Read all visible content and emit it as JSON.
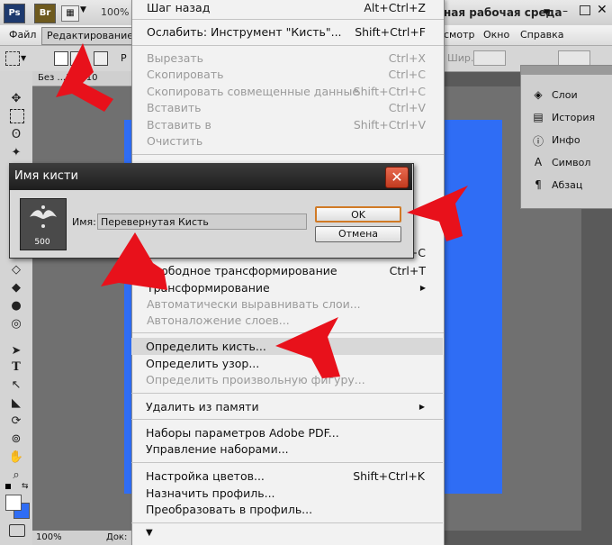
{
  "appbar": {
    "ps_label": "Ps",
    "br_label": "Br",
    "zoom": "100%",
    "workspace": "ная рабочая среда",
    "workspace_caret": "▼"
  },
  "menubar": {
    "file": "Файл",
    "edit": "Редактирование",
    "view": "смотр",
    "window": "Окно",
    "help": "Справка"
  },
  "optbar": {
    "tool_label": "Р",
    "width_label": "Шир.:"
  },
  "doc": {
    "tab": "Без ...1 @ 10",
    "status_zoom": "100%",
    "status_doc": "Док:"
  },
  "panel": {
    "items": [
      {
        "label": "Слои",
        "icon": "layers-icon"
      },
      {
        "label": "История",
        "icon": "history-icon"
      },
      {
        "label": "Инфо",
        "icon": "info-icon"
      },
      {
        "label": "Символ",
        "icon": "character-icon"
      },
      {
        "label": "Абзац",
        "icon": "paragraph-icon"
      }
    ]
  },
  "menu": {
    "undo": {
      "label": "Шаг назад",
      "shortcut": "Alt+Ctrl+Z"
    },
    "fade": {
      "label": "Ослабить: Инструмент \"Кисть\"...",
      "shortcut": "Shift+Ctrl+F"
    },
    "cut": {
      "label": "Вырезать",
      "shortcut": "Ctrl+X"
    },
    "copy": {
      "label": "Скопировать",
      "shortcut": "Ctrl+C"
    },
    "copy_merged": {
      "label": "Скопировать совмещенные данные",
      "shortcut": "Shift+Ctrl+C"
    },
    "paste": {
      "label": "Вставить",
      "shortcut": "Ctrl+V"
    },
    "paste_into": {
      "label": "Вставить в",
      "shortcut": "Shift+Ctrl+V"
    },
    "clear": {
      "label": "Очистить"
    },
    "hidden_shortcut": "Alt+Ctrl+C",
    "free_transform": {
      "label": "Свободное трансформирование",
      "shortcut": "Ctrl+T"
    },
    "transform": {
      "label": "Трансформирование"
    },
    "auto_align": {
      "label": "Автоматически выравнивать слои..."
    },
    "auto_blend": {
      "label": "Автоналожение слоев..."
    },
    "define_brush": {
      "label": "Определить кисть..."
    },
    "define_pattern": {
      "label": "Определить узор..."
    },
    "define_shape": {
      "label": "Определить произвольную фигуру..."
    },
    "purge": {
      "label": "Удалить из памяти"
    },
    "pdf_presets": {
      "label": "Наборы параметров Adobe PDF..."
    },
    "preset_manager": {
      "label": "Управление наборами..."
    },
    "color_settings": {
      "label": "Настройка цветов...",
      "shortcut": "Shift+Ctrl+K"
    },
    "assign_profile": {
      "label": "Назначить профиль..."
    },
    "convert_profile": {
      "label": "Преобразовать в профиль..."
    },
    "more_caret": "▼"
  },
  "dialog": {
    "title": "Имя кисти",
    "name_label": "Имя:",
    "name_value": "Перевернутая Кисть",
    "brush_size": "500",
    "ok": "OK",
    "cancel": "Отмена"
  },
  "colors": {
    "accent_arrow": "#e8111b",
    "doc_blue": "#2f6df5",
    "ok_border": "#d07a26"
  }
}
